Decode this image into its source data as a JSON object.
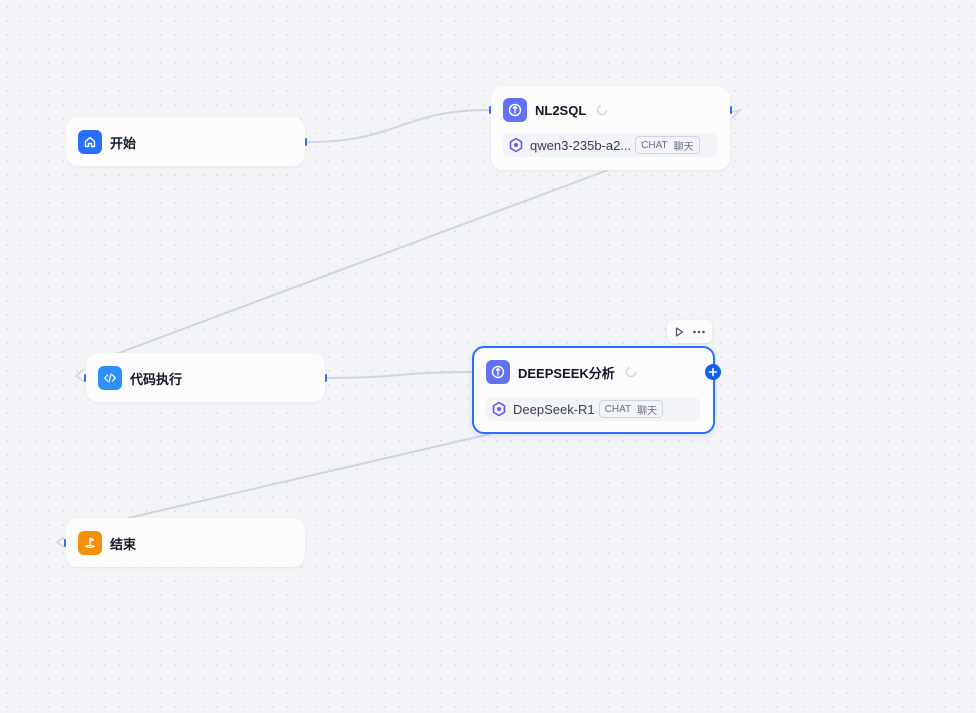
{
  "canvas": {
    "background": "#f2f4f7",
    "edge_color": "#d0d5dd",
    "handle_color": "#2970ff"
  },
  "nodes": {
    "start": {
      "title": "开始",
      "icon": "home-icon",
      "icon_color": "#2970ff"
    },
    "nl2sql": {
      "title": "NL2SQL",
      "icon": "llm-icon",
      "icon_color": "#6172f3",
      "model": {
        "name": "qwen3-235b-a2...",
        "icon": "model-provider-icon",
        "tag_mode": "CHAT",
        "tag_label": "聊天"
      }
    },
    "code": {
      "title": "代码执行",
      "icon": "code-icon",
      "icon_color": "#2e90fa"
    },
    "deepseek": {
      "title": "DEEPSEEK分析",
      "icon": "llm-icon",
      "icon_color": "#6172f3",
      "selected": true,
      "model": {
        "name": "DeepSeek-R1",
        "icon": "model-provider-icon",
        "tag_mode": "CHAT",
        "tag_label": "聊天"
      }
    },
    "end": {
      "title": "结束",
      "icon": "flag-icon",
      "icon_color": "#f79009"
    }
  },
  "toolbar": {
    "run_icon": "play-icon",
    "more_icon": "more-icon"
  },
  "add_button": {
    "icon": "plus-icon",
    "color": "#155eef"
  }
}
